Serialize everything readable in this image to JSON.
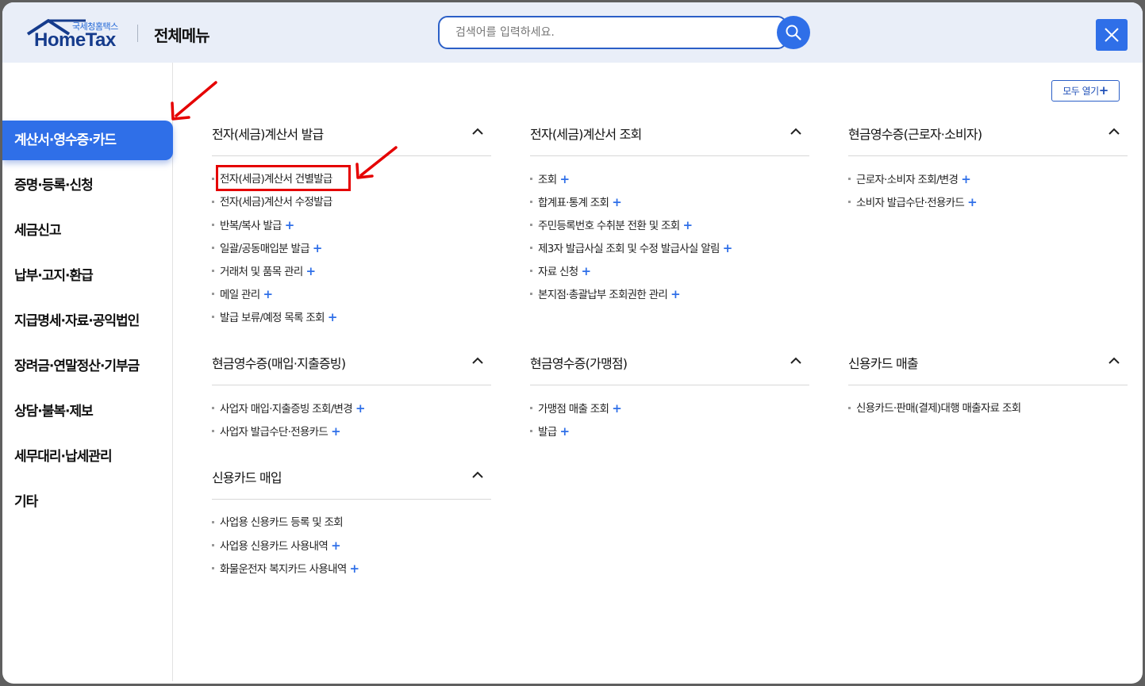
{
  "header": {
    "logo_small": "국세청홈택스",
    "logo_main": "HomeTax",
    "title": "전체메뉴",
    "search_placeholder": "검색어를 입력하세요."
  },
  "expand_all_label": "모두 열기",
  "sidebar": {
    "items": [
      {
        "label": "계산서·영수증·카드",
        "active": true
      },
      {
        "label": "증명·등록·신청"
      },
      {
        "label": "세금신고"
      },
      {
        "label": "납부·고지·환급"
      },
      {
        "label": "지급명세·자료·공익법인"
      },
      {
        "label": "장려금·연말정산·기부금"
      },
      {
        "label": "상담·불복·제보"
      },
      {
        "label": "세무대리·납세관리"
      },
      {
        "label": "기타"
      }
    ]
  },
  "sections": [
    {
      "title": "전자(세금)계산서 발급",
      "items": [
        {
          "label": "전자(세금)계산서 건별발급",
          "plus": false,
          "highlighted": true
        },
        {
          "label": "전자(세금)계산서 수정발급",
          "plus": false
        },
        {
          "label": "반복/복사 발급",
          "plus": true
        },
        {
          "label": "일괄/공동매입분 발급",
          "plus": true
        },
        {
          "label": "거래처 및 품목 관리",
          "plus": true
        },
        {
          "label": "메일 관리",
          "plus": true
        },
        {
          "label": "발급 보류/예정 목록 조회",
          "plus": true
        }
      ]
    },
    {
      "title": "전자(세금)계산서 조회",
      "items": [
        {
          "label": "조회",
          "plus": true
        },
        {
          "label": "합계표·통계 조회",
          "plus": true
        },
        {
          "label": "주민등록번호 수취분 전환 및 조회",
          "plus": true
        },
        {
          "label": "제3자 발급사실 조회 및 수정 발급사실 알림",
          "plus": true
        },
        {
          "label": "자료 신청",
          "plus": true
        },
        {
          "label": "본지점·총괄납부 조회권한 관리",
          "plus": true
        }
      ]
    },
    {
      "title": "현금영수증(근로자·소비자)",
      "items": [
        {
          "label": "근로자·소비자 조회/변경",
          "plus": true
        },
        {
          "label": "소비자 발급수단·전용카드",
          "plus": true
        }
      ]
    },
    {
      "title": "현금영수증(매입·지출증빙)",
      "items": [
        {
          "label": "사업자 매입·지출증빙 조회/변경",
          "plus": true
        },
        {
          "label": "사업자 발급수단·전용카드",
          "plus": true
        }
      ]
    },
    {
      "title": "현금영수증(가맹점)",
      "items": [
        {
          "label": "가맹점 매출 조회",
          "plus": true
        },
        {
          "label": "발급",
          "plus": true
        }
      ]
    },
    {
      "title": "신용카드 매출",
      "items": [
        {
          "label": "신용카드·판매(결제)대행 매출자료 조회",
          "plus": false
        }
      ]
    },
    {
      "title": "신용카드 매입",
      "items": [
        {
          "label": "사업용 신용카드 등록 및 조회",
          "plus": false
        },
        {
          "label": "사업용 신용카드 사용내역",
          "plus": true
        },
        {
          "label": "화물운전자 복지카드 사용내역",
          "plus": true
        }
      ]
    }
  ]
}
